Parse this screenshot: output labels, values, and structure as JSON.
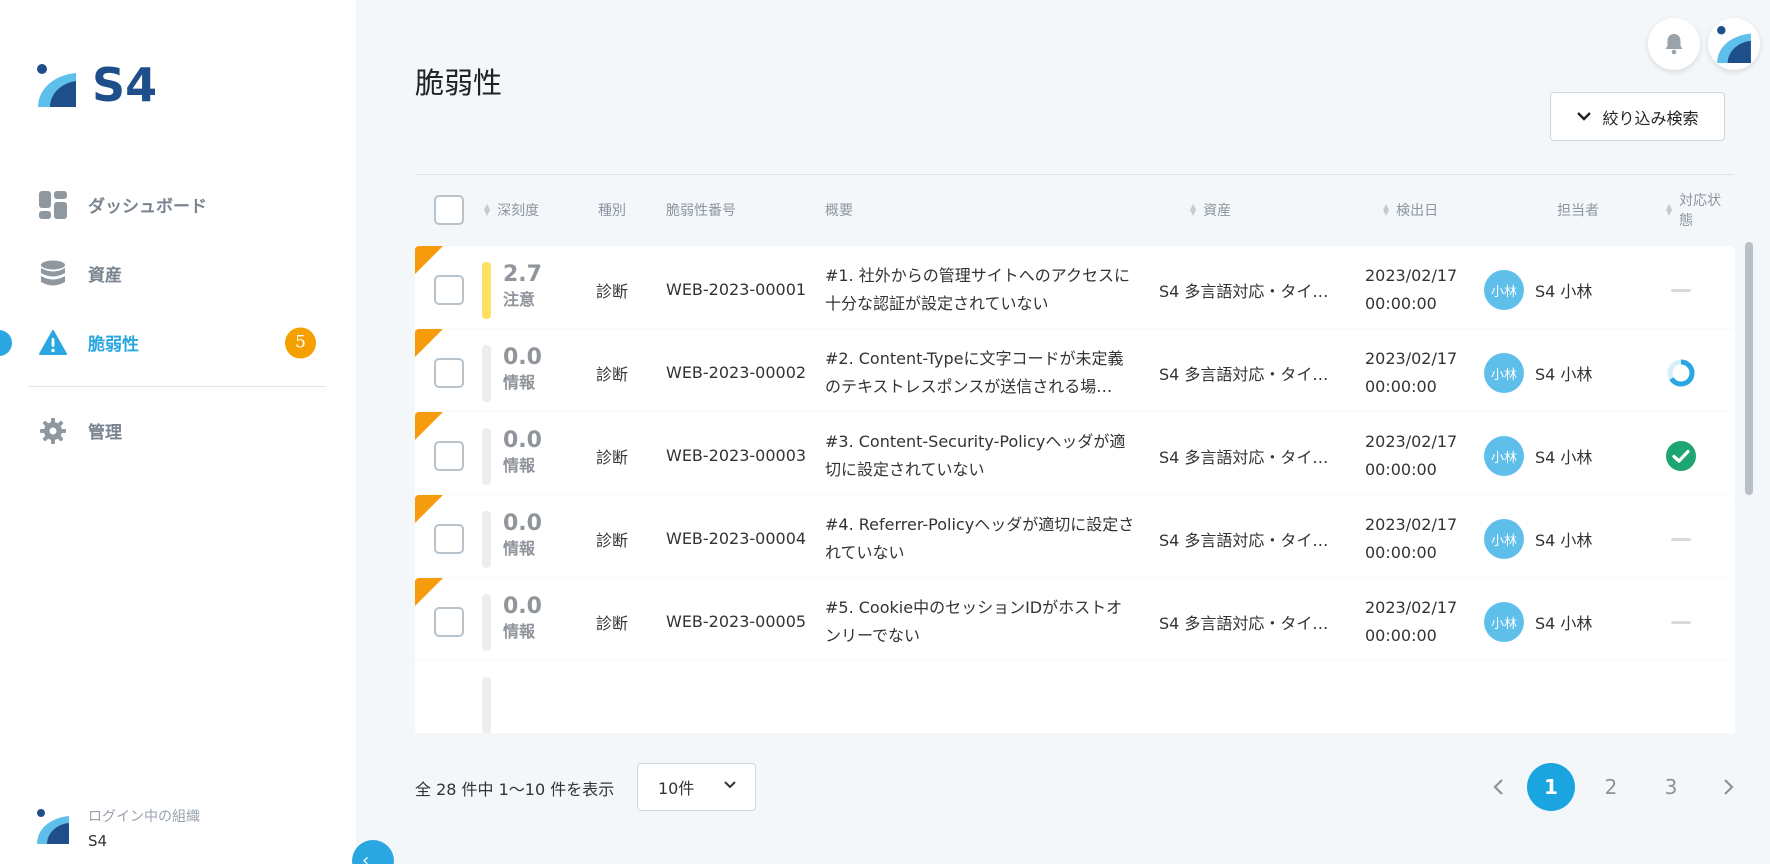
{
  "app": {
    "brand": "S4"
  },
  "sidebar": {
    "items": [
      {
        "label": "ダッシュボード",
        "icon": "dashboard-icon"
      },
      {
        "label": "資産",
        "icon": "database-icon"
      },
      {
        "label": "脆弱性",
        "icon": "warning-icon",
        "badge": "5",
        "active": true
      },
      {
        "label": "管理",
        "icon": "gear-icon"
      }
    ],
    "org_label": "ログイン中の組織",
    "org_name": "S4"
  },
  "page": {
    "title": "脆弱性",
    "filter_label": "絞り込み検索"
  },
  "table": {
    "headers": {
      "severity": "深刻度",
      "type": "種別",
      "number": "脆弱性番号",
      "summary": "概要",
      "asset": "資産",
      "detected": "検出日",
      "assignee": "担当者",
      "status": "対応状態"
    },
    "rows": [
      {
        "score": "2.7",
        "level": "注意",
        "type": "診断",
        "number": "WEB-2023-00001",
        "summary": "#1. 社外からの管理サイトへのアクセスに十分な認証が設定されていない",
        "asset": "S4 多言語対応・タイ…",
        "date": "2023/02/17",
        "time": "00:00:00",
        "avatar": "小林",
        "assignee": "S4 小林",
        "status": "none"
      },
      {
        "score": "0.0",
        "level": "情報",
        "type": "診断",
        "number": "WEB-2023-00002",
        "summary": "#2. Content-Typeに文字コードが未定義のテキストレスポンスが送信される場…",
        "asset": "S4 多言語対応・タイ…",
        "date": "2023/02/17",
        "time": "00:00:00",
        "avatar": "小林",
        "assignee": "S4 小林",
        "status": "in-progress"
      },
      {
        "score": "0.0",
        "level": "情報",
        "type": "診断",
        "number": "WEB-2023-00003",
        "summary": "#3. Content-Security-Policyヘッダが適切に設定されていない",
        "asset": "S4 多言語対応・タイ…",
        "date": "2023/02/17",
        "time": "00:00:00",
        "avatar": "小林",
        "assignee": "S4 小林",
        "status": "done"
      },
      {
        "score": "0.0",
        "level": "情報",
        "type": "診断",
        "number": "WEB-2023-00004",
        "summary": "#4. Referrer-Policyヘッダが適切に設定されていない",
        "asset": "S4 多言語対応・タイ…",
        "date": "2023/02/17",
        "time": "00:00:00",
        "avatar": "小林",
        "assignee": "S4 小林",
        "status": "none"
      },
      {
        "score": "0.0",
        "level": "情報",
        "type": "診断",
        "number": "WEB-2023-00005",
        "summary": "#5. Cookie中のセッションIDがホストオンリーでない",
        "asset": "S4 多言語対応・タイ…",
        "date": "2023/02/17",
        "time": "00:00:00",
        "avatar": "小林",
        "assignee": "S4 小林",
        "status": "none"
      }
    ]
  },
  "footer": {
    "count_text": "全 28 件中 1〜10 件を表示",
    "per_page": "10件",
    "pages": [
      "1",
      "2",
      "3"
    ],
    "current_page": "1"
  },
  "colors": {
    "accent": "#2aa7e0",
    "badge": "#f5a000",
    "corner": "#f59b0c",
    "warn": "#ffe161",
    "done": "#1ea672"
  }
}
